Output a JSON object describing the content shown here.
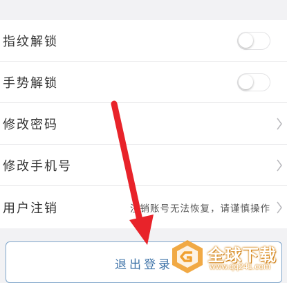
{
  "settings": {
    "fingerprint_unlock": {
      "label": "指纹解锁",
      "enabled": false
    },
    "gesture_unlock": {
      "label": "手势解锁",
      "enabled": false
    },
    "change_password": {
      "label": "修改密码"
    },
    "change_phone": {
      "label": "修改手机号"
    },
    "cancel_account": {
      "label": "用户注销",
      "note": "注销账号无法恢复，请谨慎操作"
    }
  },
  "logout": {
    "label": "退出登录"
  },
  "watermark": {
    "brand": "全球下载",
    "url": "www.qq241.com"
  },
  "colors": {
    "background": "#f2f2f4",
    "logout_text": "#3e73a8",
    "arrow": "#e8232a",
    "watermark": "#f0a030"
  },
  "icons": {
    "toggle": "switch-off",
    "chevron": "chevron-right-icon",
    "annotation": "red-arrow-icon",
    "watermark_logo": "g-logo-icon"
  }
}
